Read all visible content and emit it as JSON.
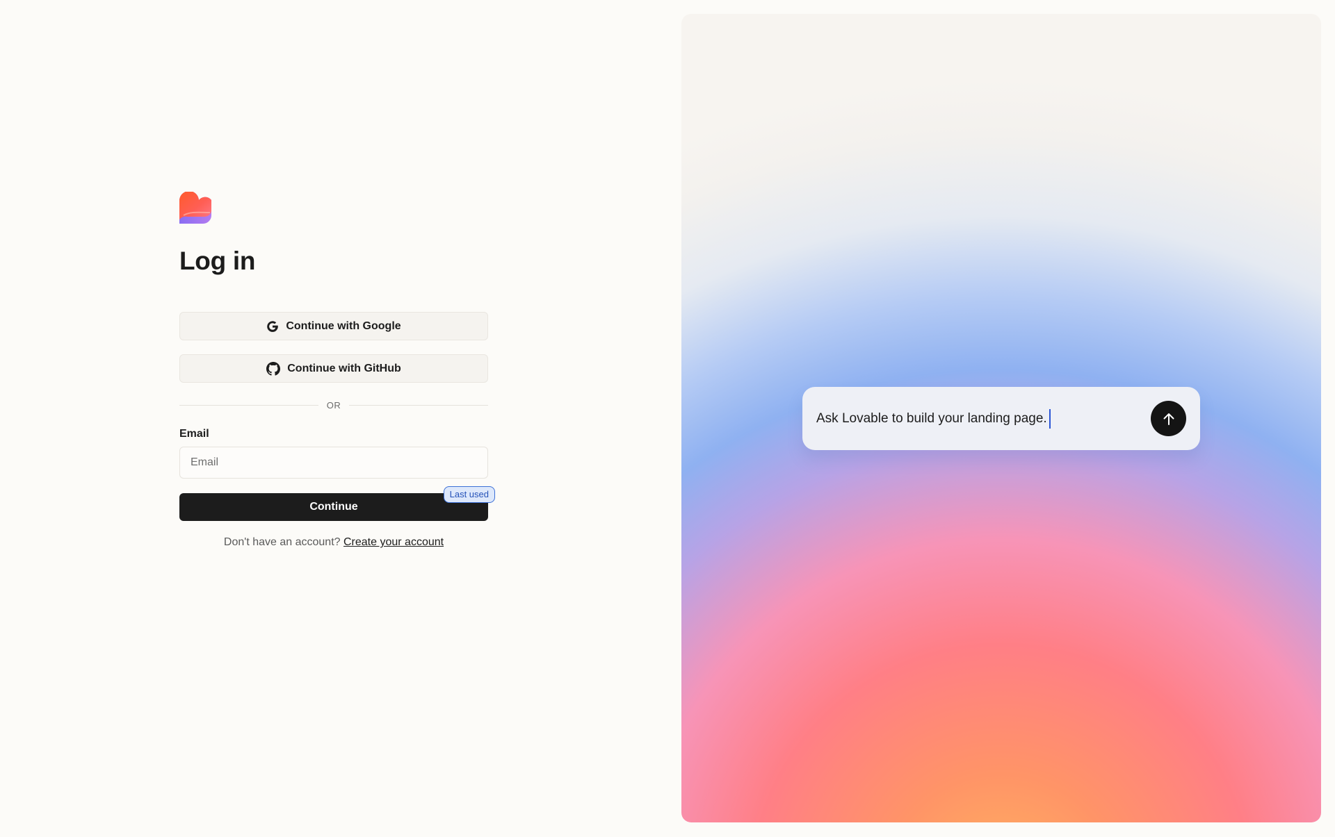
{
  "login": {
    "title": "Log in",
    "google_label": "Continue with Google",
    "github_label": "Continue with GitHub",
    "divider_text": "OR",
    "email_label": "Email",
    "email_placeholder": "Email",
    "continue_label": "Continue",
    "last_used_badge": "Last used",
    "signup_prompt": "Don't have an account?",
    "signup_link": "Create your account"
  },
  "hero": {
    "prompt_text": "Ask Lovable to build your landing page."
  },
  "icons": {
    "logo": "lovable-heart-logo",
    "google": "google-g-icon",
    "github": "github-icon",
    "send": "arrow-up-icon"
  },
  "colors": {
    "page_background": "#fcfbf8",
    "button_dark": "#1c1c1c",
    "badge_border": "#3b6fd6",
    "badge_background": "#dde8fb",
    "caret": "#2a55d6"
  }
}
